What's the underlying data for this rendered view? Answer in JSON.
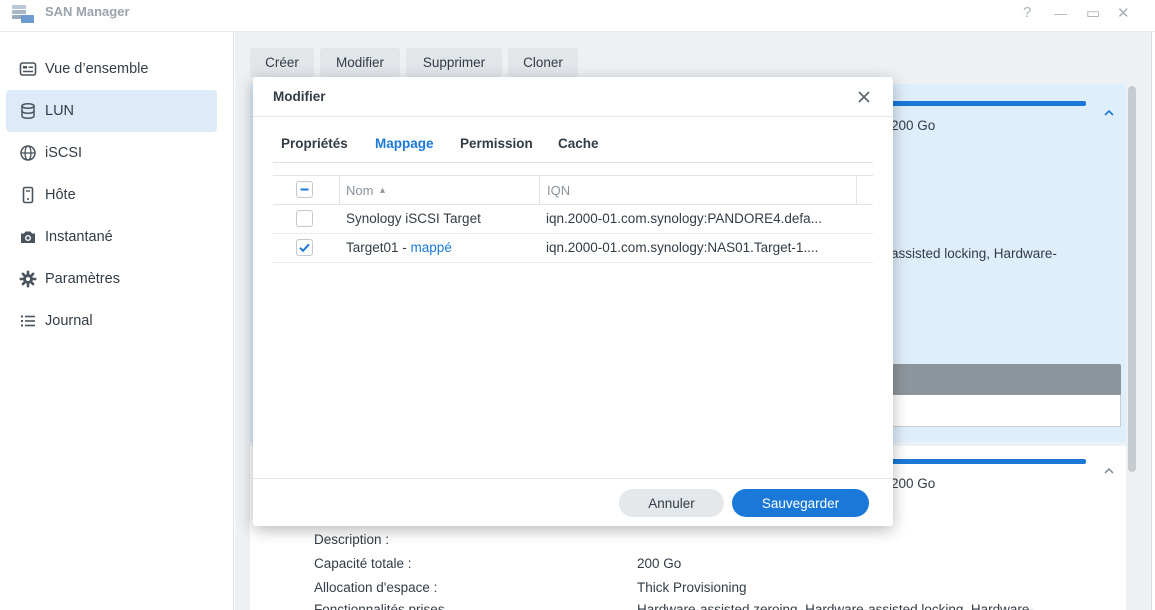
{
  "window": {
    "title": "SAN Manager",
    "controls": {
      "help": "?",
      "minimize": "—",
      "maximize": "▭",
      "close": "✕"
    }
  },
  "sidebar": {
    "items": [
      {
        "label": "Vue d’ensemble",
        "icon": "overview-icon"
      },
      {
        "label": "LUN",
        "icon": "database-icon",
        "active": true
      },
      {
        "label": "iSCSI",
        "icon": "globe-icon"
      },
      {
        "label": "Hôte",
        "icon": "host-icon"
      },
      {
        "label": "Instantané",
        "icon": "camera-icon"
      },
      {
        "label": "Paramètres",
        "icon": "gear-icon"
      },
      {
        "label": "Journal",
        "icon": "list-icon"
      }
    ]
  },
  "toolbar": {
    "create": "Créer",
    "modify": "Modifier",
    "delete": "Supprimer",
    "clone": "Cloner"
  },
  "background": {
    "capacity_top": "200 Go",
    "features_fragment": "assisted locking, Hardware-",
    "capacity_second": "200 Go",
    "details": [
      {
        "label": "Description :",
        "value": ""
      },
      {
        "label": "Capacité totale :",
        "value": "200 Go"
      },
      {
        "label": "Allocation d'espace :",
        "value": "Thick Provisioning"
      },
      {
        "label": "Fonctionnalités prises...",
        "value": "Hardware-assisted zeroing, Hardware-assisted locking, Hardware-"
      }
    ]
  },
  "dialog": {
    "title": "Modifier",
    "tabs": [
      "Propriétés",
      "Mappage",
      "Permission",
      "Cache"
    ],
    "active_tab": "Mappage",
    "columns": {
      "name": "Nom",
      "sort_indicator": "▴",
      "iqn": "IQN"
    },
    "rows": [
      {
        "name": "Synology iSCSI Target",
        "suffix": "",
        "status": "",
        "iqn": "iqn.2000-01.com.synology:PANDORE4.defa...",
        "checked": false
      },
      {
        "name": "Target01",
        "suffix": " - ",
        "status": "mappé",
        "iqn": "iqn.2000-01.com.synology:NAS01.Target-1....",
        "checked": true
      }
    ],
    "buttons": {
      "cancel": "Annuler",
      "save": "Sauvegarder"
    }
  },
  "colors": {
    "accent": "#1a79d8",
    "sidebar_active": "#ddeaf7",
    "main_bg": "#eef1f3"
  }
}
